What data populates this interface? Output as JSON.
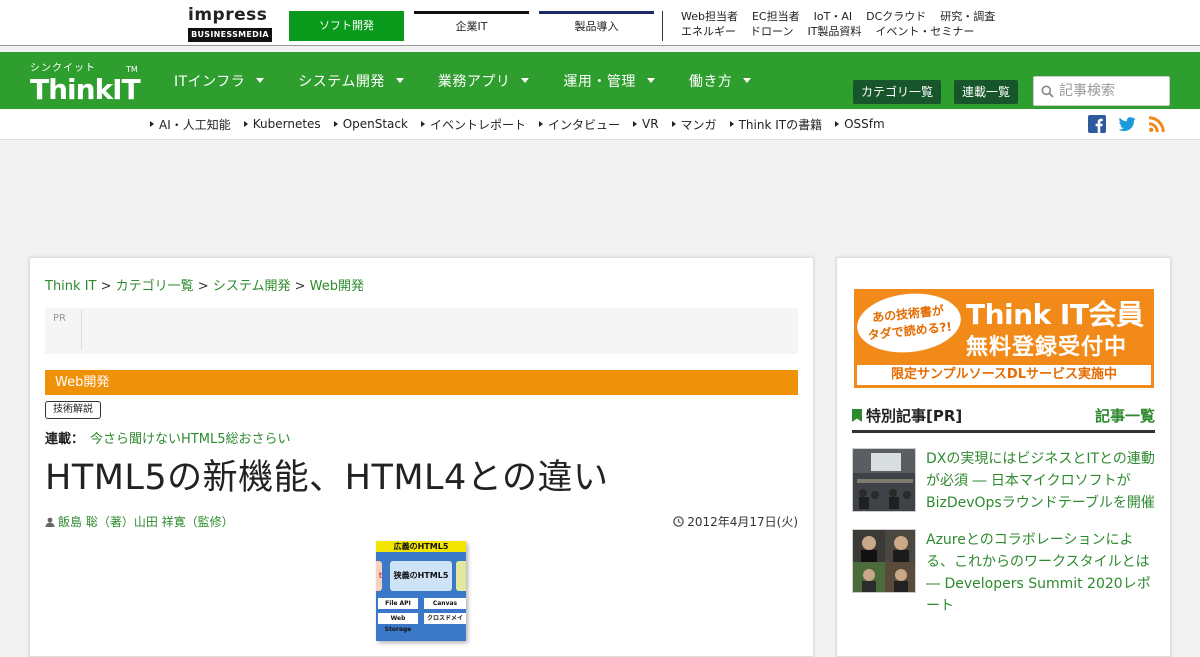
{
  "impress": {
    "logo_word": "impress",
    "logo_sub": "BUSINESSMEDIA",
    "tabs": [
      "ソフト開発",
      "企業IT",
      "製品導入"
    ],
    "links_row1": [
      "Web担当者",
      "EC担当者",
      "IoT・AI",
      "DCクラウド",
      "研究・調査"
    ],
    "links_row2": [
      "エネルギー",
      "ドローン",
      "IT製品資料",
      "イベント・セミナー"
    ]
  },
  "site": {
    "logo_kana": "シンクイット",
    "logo_main": "ThinkIT",
    "logo_tm": "TM",
    "nav": [
      "ITインフラ",
      "システム開発",
      "業務アプリ",
      "運用・管理",
      "働き方"
    ],
    "btn_category": "カテゴリ一覧",
    "btn_series": "連載一覧",
    "search_placeholder": "記事検索"
  },
  "tags": [
    "AI・人工知能",
    "Kubernetes",
    "OpenStack",
    "イベントレポート",
    "インタビュー",
    "VR",
    "マンガ",
    "Think ITの書籍",
    "OSSfm"
  ],
  "social": {
    "facebook": "facebook-icon",
    "twitter": "twitter-icon",
    "rss": "rss-icon"
  },
  "article": {
    "breadcrumb": [
      "Think IT",
      "カテゴリ一覧",
      "システム開発",
      "Web開発"
    ],
    "pr_label": "PR",
    "category": "Web開発",
    "genre": "技術解説",
    "series_label": "連載：",
    "series_title": "今さら聞けないHTML5総おさらい",
    "title": "HTML5の新機能、HTML4との違い",
    "author": "飯島 聡（著）山田 祥寛（監修）",
    "date": "2012年4月17日(火)",
    "figure": {
      "header": "広義のHTML5",
      "main": "狭義のHTML5",
      "left": "t",
      "chips": [
        "File API",
        "Canvas",
        "Web Storage",
        "クロスドメイ"
      ]
    }
  },
  "sidebar": {
    "banner_bubble_1": "あの技術書が",
    "banner_bubble_2": "タダで読める?!",
    "banner_line1": "Think IT会員",
    "banner_line2": "無料登録受付中",
    "banner_line3": "限定サンプルソースDLサービス実施中",
    "featured_title": "特別記事[PR]",
    "featured_more": "記事一覧",
    "items": [
      {
        "text": "DXの実現にはビジネスとITとの連動が必須 ― 日本マイクロソフトがBizDevOpsラウンドテーブルを開催"
      },
      {
        "text": "Azureとのコラボレーションによる、これからのワークスタイルとは ― Developers Summit 2020レポート"
      }
    ]
  },
  "colors": {
    "brand_green": "#2e9e2e",
    "accent_orange": "#f0910a",
    "link_green": "#2e8a2e"
  }
}
